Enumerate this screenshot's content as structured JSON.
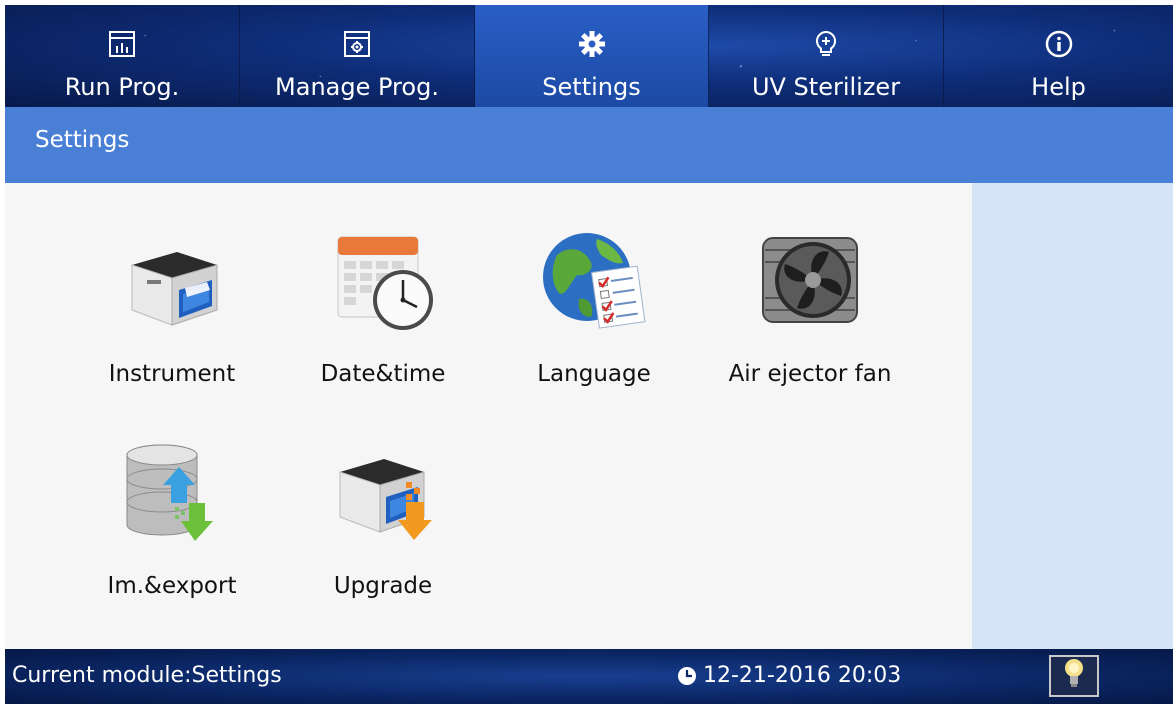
{
  "tabs": [
    {
      "label": "Run Prog.",
      "icon": "chart-icon"
    },
    {
      "label": "Manage Prog.",
      "icon": "manage-icon"
    },
    {
      "label": "Settings",
      "icon": "gear-icon",
      "active": true
    },
    {
      "label": "UV Sterilizer",
      "icon": "lightbulb-icon"
    },
    {
      "label": "Help",
      "icon": "info-icon"
    }
  ],
  "header": {
    "title": "Settings"
  },
  "items": [
    {
      "label": "Instrument",
      "icon": "printer-icon"
    },
    {
      "label": "Date&time",
      "icon": "calendar-clock-icon"
    },
    {
      "label": "Language",
      "icon": "globe-checklist-icon"
    },
    {
      "label": "Air ejector fan",
      "icon": "fan-icon"
    },
    {
      "label": "Im.&export",
      "icon": "database-transfer-icon"
    },
    {
      "label": "Upgrade",
      "icon": "printer-upgrade-icon"
    }
  ],
  "status": {
    "module": "Current module:Settings",
    "datetime": "12-21-2016 20:03"
  },
  "colors": {
    "tab_bg": "#0e2d78",
    "tab_active": "#2a5fc6",
    "title_strip": "#4a7fd6",
    "content_bg": "#f6f6f6",
    "side_panel": "#d5e4f6"
  }
}
